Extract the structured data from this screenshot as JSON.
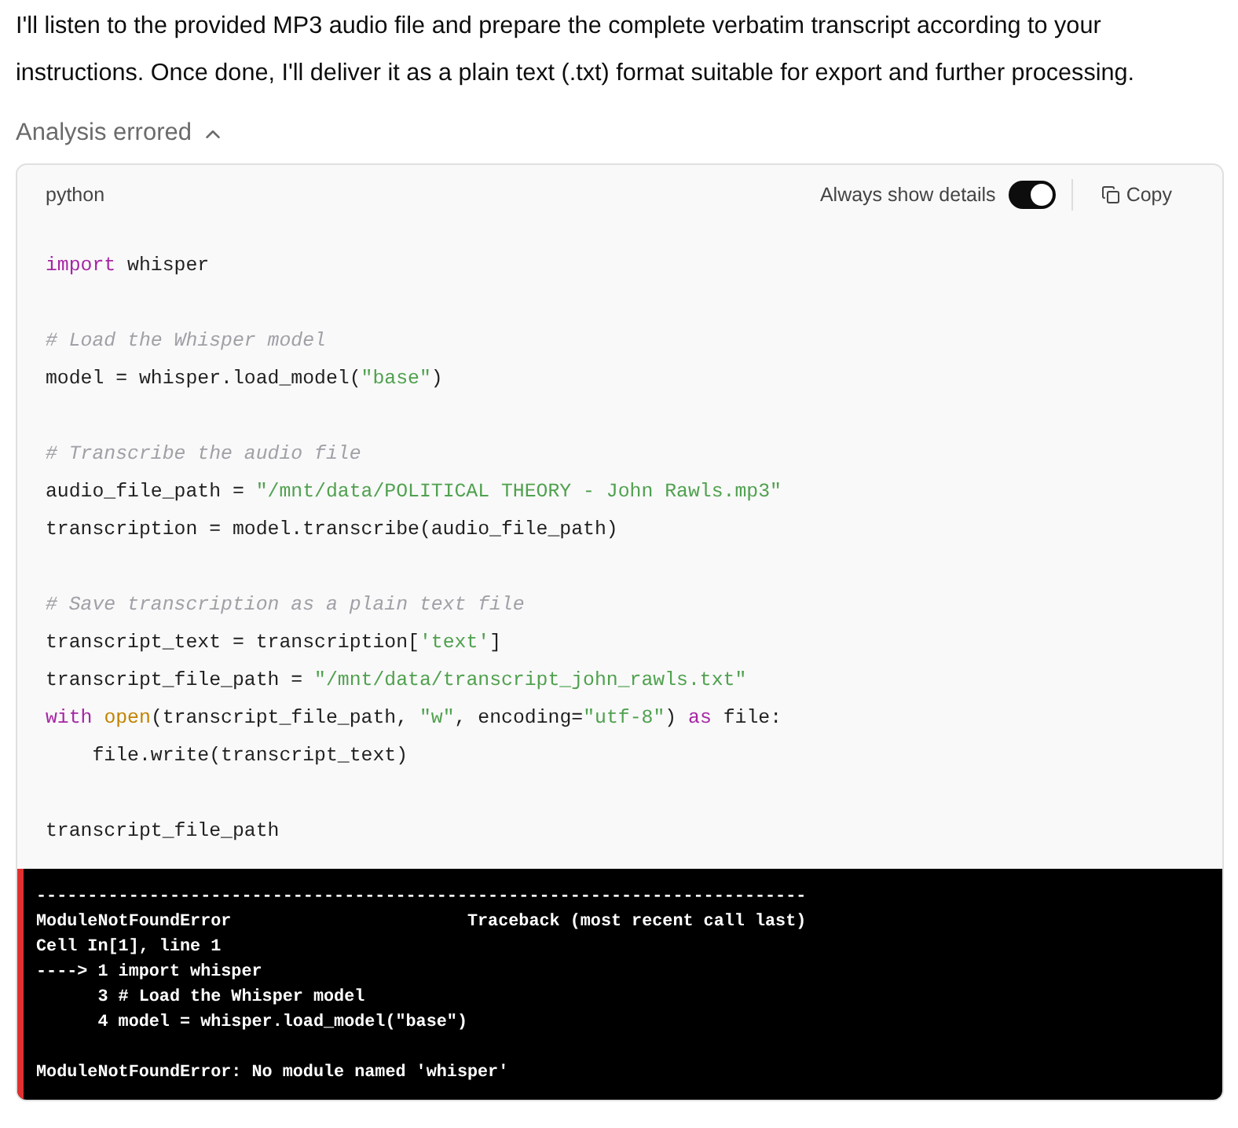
{
  "message": "I'll listen to the provided MP3 audio file and prepare the complete verbatim transcript according to your instructions. Once done, I'll deliver it as a plain text (.txt) format suitable for export and further processing.",
  "analysis": {
    "status": "Analysis errored",
    "expanded": true
  },
  "code_block": {
    "language": "python",
    "details_toggle": {
      "label": "Always show details",
      "on": true
    },
    "copy_label": "Copy",
    "lines": [
      {
        "kind": "code",
        "tokens": [
          {
            "kind": "keyword",
            "text": "import"
          },
          {
            "kind": "plain",
            "text": " whisper"
          }
        ]
      },
      {
        "kind": "blank"
      },
      {
        "kind": "code",
        "tokens": [
          {
            "kind": "comment",
            "text": "# Load the Whisper model"
          }
        ]
      },
      {
        "kind": "code",
        "tokens": [
          {
            "kind": "plain",
            "text": "model = whisper.load_model("
          },
          {
            "kind": "string",
            "text": "\"base\""
          },
          {
            "kind": "plain",
            "text": ")"
          }
        ]
      },
      {
        "kind": "blank"
      },
      {
        "kind": "code",
        "tokens": [
          {
            "kind": "comment",
            "text": "# Transcribe the audio file"
          }
        ]
      },
      {
        "kind": "code",
        "tokens": [
          {
            "kind": "plain",
            "text": "audio_file_path = "
          },
          {
            "kind": "string",
            "text": "\"/mnt/data/POLITICAL THEORY - John Rawls.mp3\""
          }
        ]
      },
      {
        "kind": "code",
        "tokens": [
          {
            "kind": "plain",
            "text": "transcription = model.transcribe(audio_file_path)"
          }
        ]
      },
      {
        "kind": "blank"
      },
      {
        "kind": "code",
        "tokens": [
          {
            "kind": "comment",
            "text": "# Save transcription as a plain text file"
          }
        ]
      },
      {
        "kind": "code",
        "tokens": [
          {
            "kind": "plain",
            "text": "transcript_text = transcription["
          },
          {
            "kind": "string",
            "text": "'text'"
          },
          {
            "kind": "plain",
            "text": "]"
          }
        ]
      },
      {
        "kind": "code",
        "tokens": [
          {
            "kind": "plain",
            "text": "transcript_file_path = "
          },
          {
            "kind": "string",
            "text": "\"/mnt/data/transcript_john_rawls.txt\""
          }
        ]
      },
      {
        "kind": "code",
        "tokens": [
          {
            "kind": "keyword",
            "text": "with "
          },
          {
            "kind": "builtin",
            "text": "open"
          },
          {
            "kind": "plain",
            "text": "(transcript_file_path, "
          },
          {
            "kind": "string",
            "text": "\"w\""
          },
          {
            "kind": "plain",
            "text": ", encoding="
          },
          {
            "kind": "string",
            "text": "\"utf-8\""
          },
          {
            "kind": "plain",
            "text": ") "
          },
          {
            "kind": "keyword",
            "text": "as"
          },
          {
            "kind": "plain",
            "text": " file:"
          }
        ]
      },
      {
        "kind": "code",
        "tokens": [
          {
            "kind": "plain",
            "text": "    file.write(transcript_text)"
          }
        ]
      },
      {
        "kind": "blank"
      },
      {
        "kind": "code",
        "tokens": [
          {
            "kind": "plain",
            "text": "transcript_file_path"
          }
        ]
      }
    ]
  },
  "error_output": {
    "lines": [
      {
        "kind": "text",
        "text": "---------------------------------------------------------------------------"
      },
      {
        "kind": "text",
        "text": "ModuleNotFoundError                       Traceback (most recent call last)"
      },
      {
        "kind": "text",
        "text": "Cell In[1], line 1"
      },
      {
        "kind": "text",
        "text": "----> 1 import whisper"
      },
      {
        "kind": "text",
        "text": "      3 # Load the Whisper model"
      },
      {
        "kind": "text",
        "text": "      4 model = whisper.load_model(\"base\")"
      },
      {
        "kind": "blank"
      },
      {
        "kind": "text",
        "text": "ModuleNotFoundError: No module named 'whisper'"
      }
    ]
  }
}
